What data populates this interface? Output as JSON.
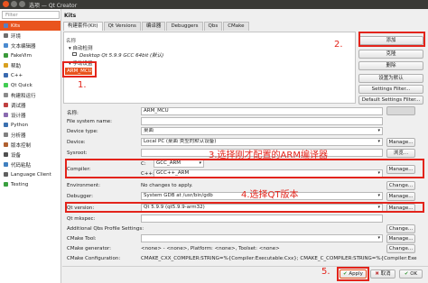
{
  "window": {
    "title": "选项 — Qt Creator"
  },
  "sidebar": {
    "filter_placeholder": "Filter",
    "items": [
      {
        "label": "Kits",
        "color": "#5a7fc0"
      },
      {
        "label": "环境",
        "color": "#6e6e6e"
      },
      {
        "label": "文本编辑器",
        "color": "#4a8ad0"
      },
      {
        "label": "FakeVim",
        "color": "#3a9a3a"
      },
      {
        "label": "帮助",
        "color": "#d8a020"
      },
      {
        "label": "C++",
        "color": "#3a6ab0"
      },
      {
        "label": "Qt Quick",
        "color": "#41cd52"
      },
      {
        "label": "构建和运行",
        "color": "#8a8a8a"
      },
      {
        "label": "调试器",
        "color": "#c04040"
      },
      {
        "label": "设计器",
        "color": "#8a6ab0"
      },
      {
        "label": "Python",
        "color": "#3a70b0"
      },
      {
        "label": "分析器",
        "color": "#808080"
      },
      {
        "label": "版本控制",
        "color": "#b06030"
      },
      {
        "label": "设备",
        "color": "#505050"
      },
      {
        "label": "代码粘贴",
        "color": "#4080c0"
      },
      {
        "label": "Language Client",
        "color": "#606060"
      },
      {
        "label": "Testing",
        "color": "#3aa040"
      }
    ]
  },
  "main": {
    "section_title": "Kits",
    "tabs": [
      "构建套件(Kit)",
      "Qt Versions",
      "编译器",
      "Debuggers",
      "Qbs",
      "CMake"
    ],
    "tree": {
      "header": "名称",
      "auto_group": "▾ 自动检测",
      "auto_item": "Desktop Qt 5.9.9 GCC 64bit (默认)",
      "manual_group": "▾ 手动设置",
      "manual_item": "ARM_MCU"
    },
    "side_buttons": [
      "添加",
      "克隆",
      "删除",
      "设置为默认",
      "Settings Filter...",
      "Default Settings Filter..."
    ],
    "form": {
      "name_label": "名称:",
      "name_value": "ARM_MCU",
      "filesystem_label": "File system name:",
      "devtype_label": "Device type:",
      "devtype_value": "桌面",
      "device_label": "Device:",
      "device_value": "Local PC (桌面 类型的默认设备)",
      "sysroot_label": "Sysroot:",
      "compiler_label": "Compiler:",
      "compiler_c_lang": "C:",
      "compiler_c_value": "GCC_ARM",
      "compiler_cpp_lang": "C++:",
      "compiler_cpp_value": "GCC++_ARM",
      "env_label": "Environment:",
      "env_value": "No changes to apply.",
      "debugger_label": "Debugger:",
      "debugger_value": "System GDB at /usr/bin/gdb",
      "qtversion_label": "Qt version:",
      "qtversion_value": "Qt 5.9.9 (qt5.9.9-arm32)",
      "mkspec_label": "Qt mkspec:",
      "qbs_label": "Additional Qbs Profile Settings:",
      "cmake_tool_label": "CMake Tool:",
      "cmake_gen_label": "CMake generator:",
      "cmake_gen_value": "<none> - <none>, Platform: <none>, Toolset: <none>",
      "cmake_config_label": "CMake Configuration:",
      "cmake_config_value": "CMAKE_CXX_COMPILER:STRING=%{Compiler:Executable:Cxx}; CMAKE_C_COMPILER:STRING=%{Compiler:Exe",
      "browse_label": "浏览...",
      "manage_label": "Manage...",
      "change_label": "Change..."
    },
    "annotations": {
      "a1": "1.",
      "a2": "2.",
      "a3": "3.选择刚才配置的ARM编译器",
      "a4": "4.选择QT版本",
      "a5": "5."
    },
    "bottom": {
      "apply": "Apply",
      "cancel": "取消",
      "ok": "OK"
    }
  }
}
